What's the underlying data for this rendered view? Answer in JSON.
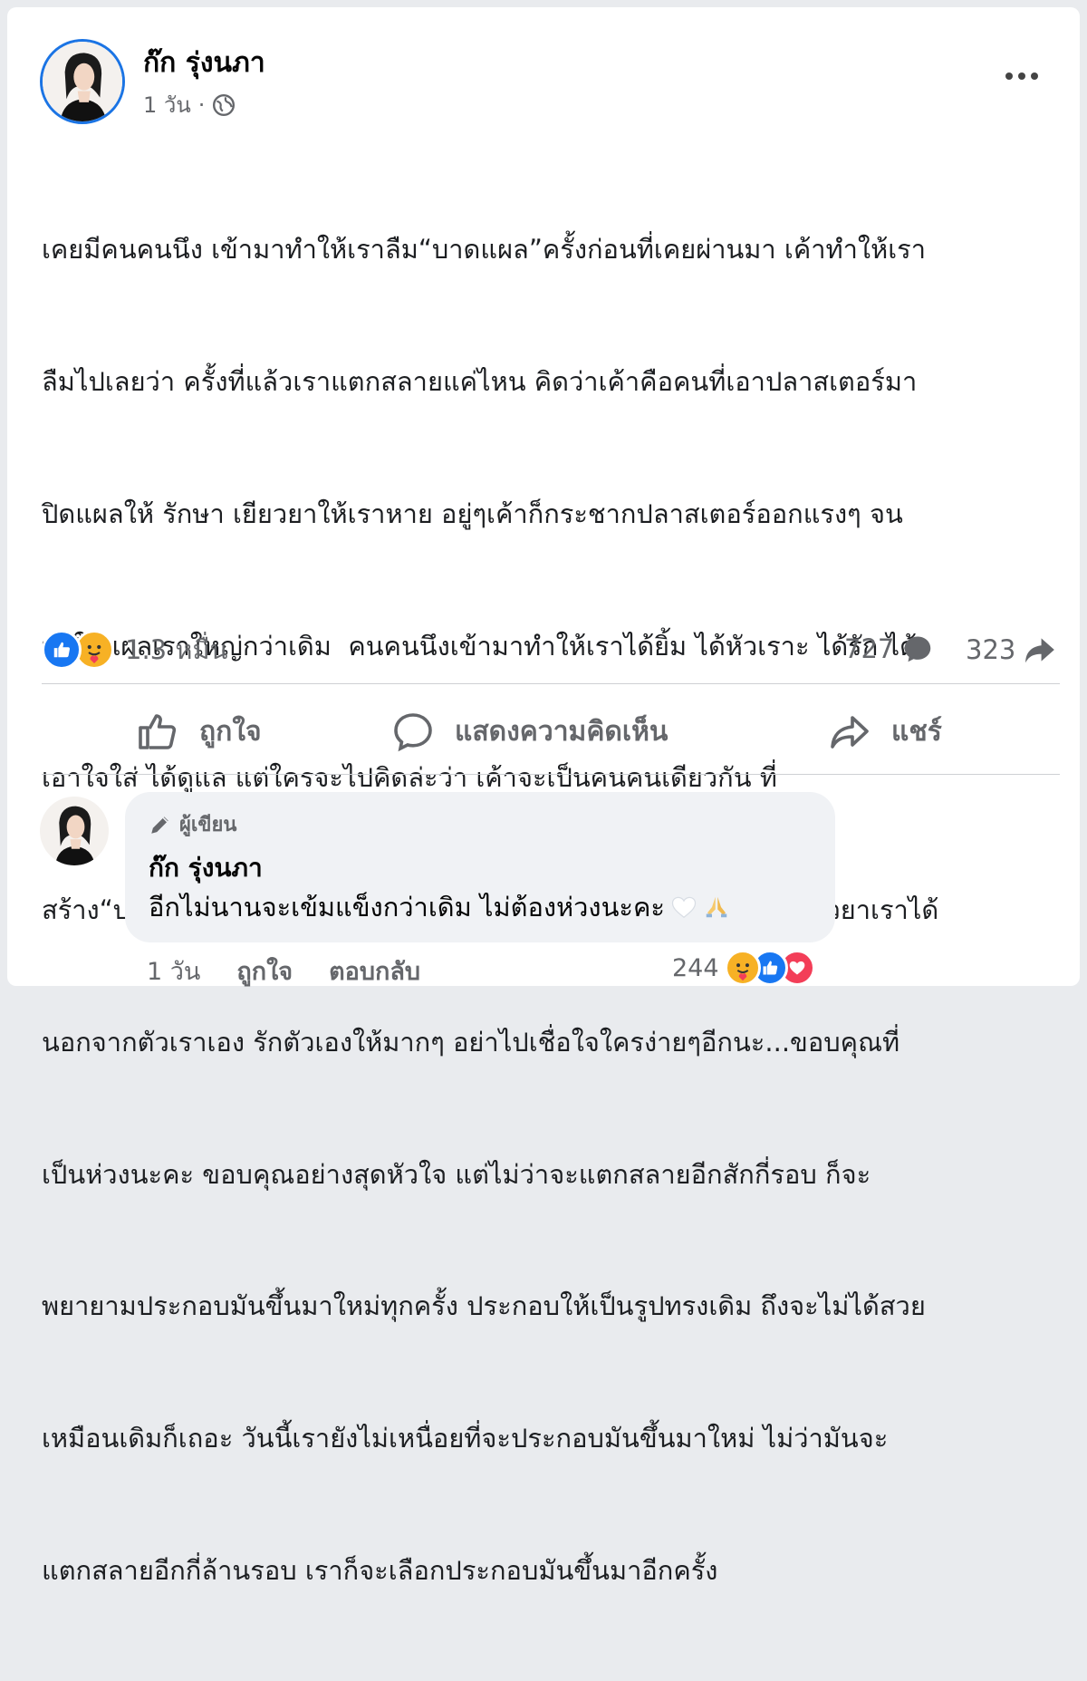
{
  "post": {
    "author": "ก๊ก รุ่งนภา",
    "time": "1 วัน",
    "separator": "·",
    "body_lines": [
      "เคยมีคนคนนึง เข้ามาทำให้เราลืม“บาดแผล”ครั้งก่อนที่เคยผ่านมา เค้าทำให้เรา",
      "ลืมไปเลยว่า ครั้งที่แล้วเราแตกสลายแค่ไหน คิดว่าเค้าคือคนที่เอาปลาสเตอร์มา",
      "ปิดแผลให้ รักษา เยียวยาให้เราหาย อยู่ๆเค้าก็กระชากปลาสเตอร์ออกแรงๆ จน",
      "ทำให้แผลเราใหญ่กว่าเดิม  คนคนนึงเข้ามาทำให้เราได้ยิ้ม ได้หัวเราะ ได้รัก ได้",
      "เอาใจใส่ ได้ดูแล แต่ใครจะไปคิดล่ะว่า เค้าจะเป็นคนคนเดียวกัน ที่",
      "สร้าง“บาดแผลใหม่”ขึ้นมา และใหญ่กว่าเดิม มันทำให้รู้ว่า ไม่มีใครเยียวยาเราได้",
      "นอกจากตัวเราเอง รักตัวเองให้มากๆ อย่าไปเชื่อใจใครง่ายๆอีกนะ...ขอบคุณที่",
      "เป็นห่วงนะคะ ขอบคุณอย่างสุดหัวใจ แต่ไม่ว่าจะแตกสลายอีกสักกี่รอบ ก็จะ",
      "พยายามประกอบมันขึ้นมาใหม่ทุกครั้ง ประกอบให้เป็นรูปทรงเดิม ถึงจะไม่ได้สวย",
      "เหมือนเดิมก็เถอะ วันนี้เรายังไม่เหนื่อยที่จะประกอบมันขึ้นมาใหม่ ไม่ว่ามันจะ",
      "แตกสลายอีกกี่ล้านรอบ เราก็จะเลือกประกอบมันขึ้นมาอีกครั้ง"
    ],
    "reaction_count": "1.3 หมื่น",
    "comment_count": "727",
    "share_count": "323"
  },
  "actions": {
    "like": "ถูกใจ",
    "comment": "แสดงความคิดเห็น",
    "share": "แชร์"
  },
  "comment": {
    "badge": "ผู้เขียน",
    "author": "ก๊ก รุ่งนภา",
    "text": "อีกไม่นานจะเข้มแข็งกว่าเดิม ไม่ต้องห่วงนะคะ",
    "time": "1 วัน",
    "like": "ถูกใจ",
    "reply": "ตอบกลับ",
    "reaction_count": "244"
  },
  "icons": {
    "globe": "globe-icon",
    "more": "more-options-icon",
    "like": "thumbs-up-icon",
    "comment": "speech-bubble-icon",
    "share": "share-arrow-icon",
    "care": "care-emoji-icon",
    "heart": "heart-icon",
    "pen": "pen-icon"
  },
  "colors": {
    "accent": "#1877f2",
    "muted_text": "#65676b",
    "bubble": "#f0f2f5",
    "care": "#f7b125",
    "love": "#f33e58"
  }
}
